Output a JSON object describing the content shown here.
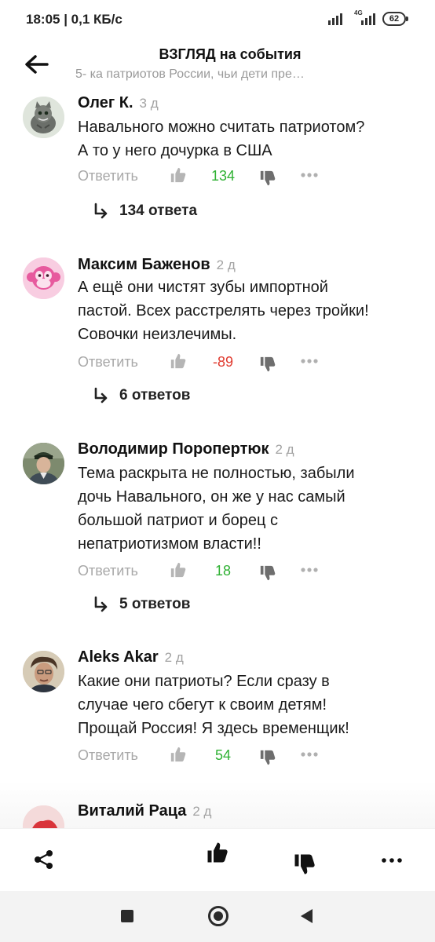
{
  "status_bar": {
    "time_speed": "18:05 | 0,1 КБ/с",
    "network_label": "4G",
    "battery": "62"
  },
  "header": {
    "title": "ВЗГЛЯД на события",
    "subtitle": "5- ка патриотов России, чьи дети пре…"
  },
  "comments": [
    {
      "author": "Олег К.",
      "time": "3 д",
      "text": [
        "Навального можно считать патриотом?",
        "А то у него дочурка в США"
      ],
      "reply_label": "Ответить",
      "score": "134",
      "score_sign": "positive",
      "replies_label": "134 ответа",
      "avatar_icon": "cat-avatar-icon"
    },
    {
      "author": "Максим Баженов",
      "time": "2 д",
      "text": [
        "А ещё они чистят зубы импортной",
        "пастой. Всех расстрелять через тройки!",
        "Совочки неизлечимы."
      ],
      "reply_label": "Ответить",
      "score": "-89",
      "score_sign": "negative",
      "replies_label": "6 ответов",
      "avatar_icon": "monkey-avatar-icon"
    },
    {
      "author": "Володимир Поропертюк",
      "time": "2 д",
      "text": [
        "Тема раскрыта не полностью, забыли",
        "дочь Навального, он же у нас самый",
        "большой патриот и борец с",
        "непатриотизмом власти!!"
      ],
      "reply_label": "Ответить",
      "score": "18",
      "score_sign": "positive",
      "replies_label": "5 ответов",
      "avatar_icon": "person-avatar-icon"
    },
    {
      "author": "Aleks Akar",
      "time": "2 д",
      "text": [
        "Какие они патриоты? Если сразу в",
        "случае чего сбегут к своим детям!",
        "Прощай Россия! Я здесь временщик!"
      ],
      "reply_label": "Ответить",
      "score": "54",
      "score_sign": "positive",
      "avatar_icon": "person-avatar-icon"
    },
    {
      "author": "Виталий Раца",
      "time": "2 д",
      "avatar_icon": "person-avatar-icon"
    }
  ],
  "colors": {
    "positive": "#2fb133",
    "negative": "#e03a2f",
    "muted": "#a8a8a8"
  },
  "toolbar_icons": [
    "share-icon",
    "thumbs-up-icon",
    "thumbs-down-icon",
    "more-icon"
  ],
  "nav_icons": [
    "recent-apps-icon",
    "home-icon",
    "back-nav-icon"
  ]
}
